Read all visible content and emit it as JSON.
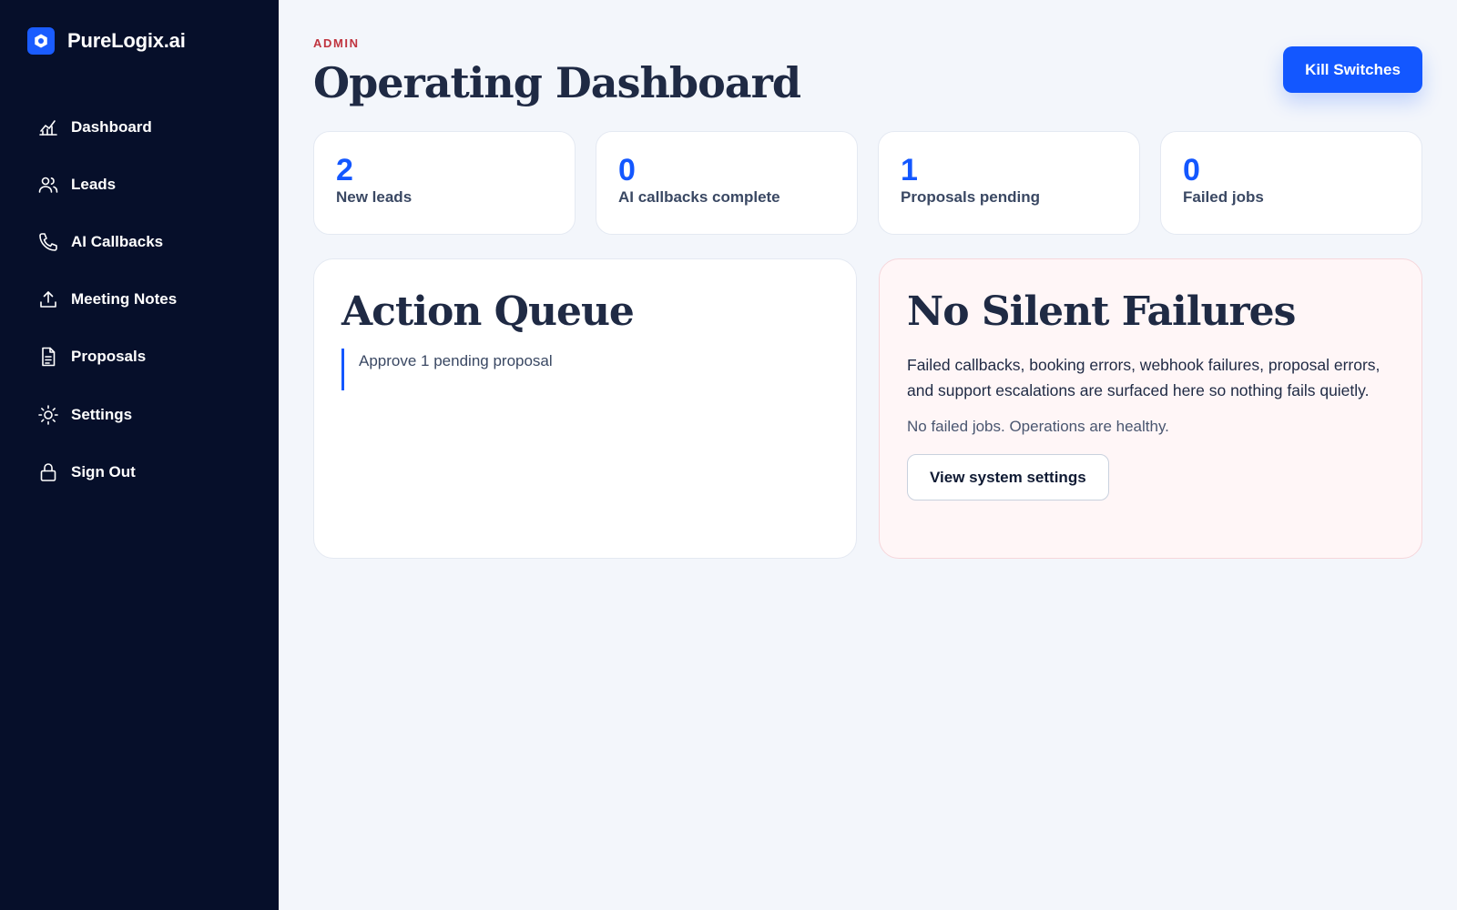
{
  "brand": {
    "name": "PureLogix.ai",
    "logo_icon": "hexagon-icon"
  },
  "colors": {
    "accent": "#1357ff",
    "sidebar": "#060f2a",
    "alert": "#c0343f"
  },
  "sidebar": {
    "items": [
      {
        "label": "Dashboard",
        "icon": "chart-icon"
      },
      {
        "label": "Leads",
        "icon": "users-icon"
      },
      {
        "label": "AI Callbacks",
        "icon": "phone-icon"
      },
      {
        "label": "Meeting Notes",
        "icon": "upload-icon"
      },
      {
        "label": "Proposals",
        "icon": "document-icon"
      },
      {
        "label": "Settings",
        "icon": "sun-icon"
      },
      {
        "label": "Sign Out",
        "icon": "lock-icon"
      }
    ]
  },
  "header": {
    "eyebrow": "ADMIN",
    "title": "Operating Dashboard",
    "kill_switches_label": "Kill Switches"
  },
  "stats": [
    {
      "value": "2",
      "label": "New leads"
    },
    {
      "value": "0",
      "label": "AI callbacks complete"
    },
    {
      "value": "1",
      "label": "Proposals pending"
    },
    {
      "value": "0",
      "label": "Failed jobs"
    }
  ],
  "action_queue": {
    "title": "Action Queue",
    "items": [
      "Approve 1 pending proposal"
    ]
  },
  "failures": {
    "title": "No Silent Failures",
    "description": "Failed callbacks, booking errors, webhook failures, proposal errors, and support escalations are surfaced here so nothing fails quietly.",
    "status": "No failed jobs. Operations are healthy.",
    "button_label": "View system settings"
  }
}
